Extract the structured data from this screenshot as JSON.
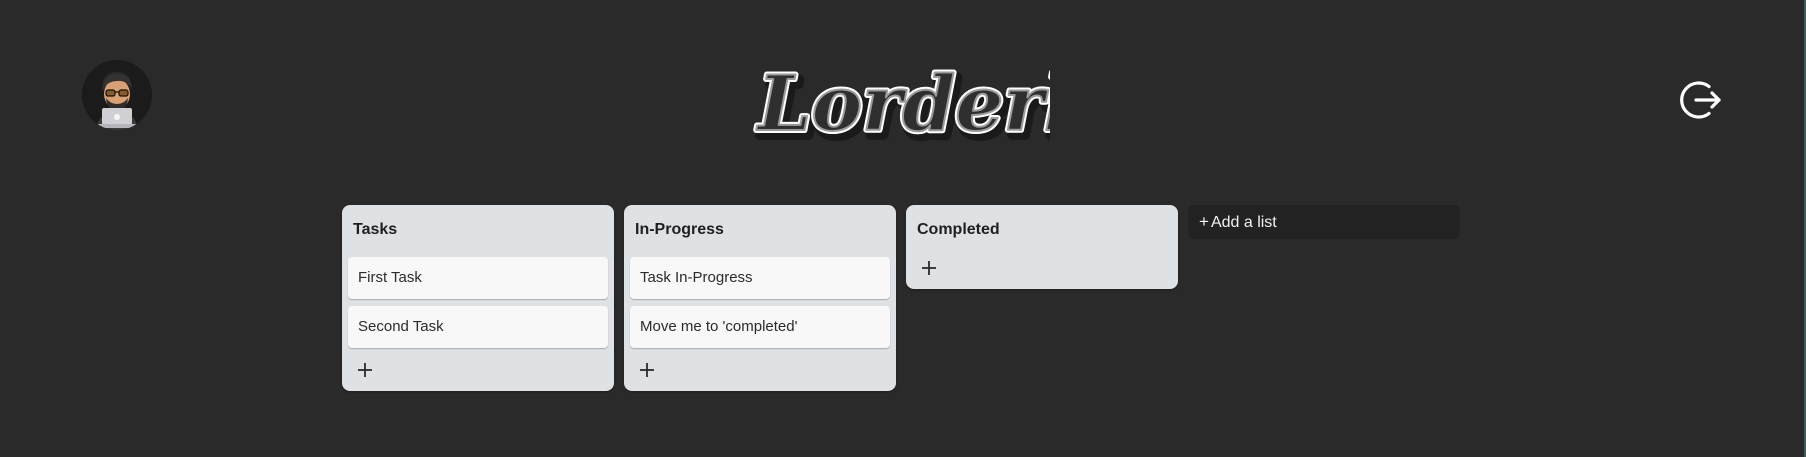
{
  "header": {
    "logo_text": "Lorderly",
    "avatar_icon": "memoji-laptop-avatar",
    "logout_icon": "logout-icon"
  },
  "board": {
    "lists": [
      {
        "title": "Tasks",
        "cards": [
          "First Task",
          "Second Task"
        ],
        "add_icon": "plus-icon"
      },
      {
        "title": "In-Progress",
        "cards": [
          "Task In-Progress",
          "Move me to 'completed'"
        ],
        "add_icon": "plus-icon"
      },
      {
        "title": "Completed",
        "cards": [],
        "add_icon": "plus-icon"
      }
    ],
    "add_list": {
      "plus": "+",
      "label": "Add a list"
    }
  },
  "colors": {
    "background": "#2a2a2a",
    "list_bg": "#dfe2e5",
    "card_bg": "#f8f8f8",
    "add_list_bg": "#222222",
    "text_dark": "#1f1f1f",
    "text_light": "#f2f2f2"
  }
}
